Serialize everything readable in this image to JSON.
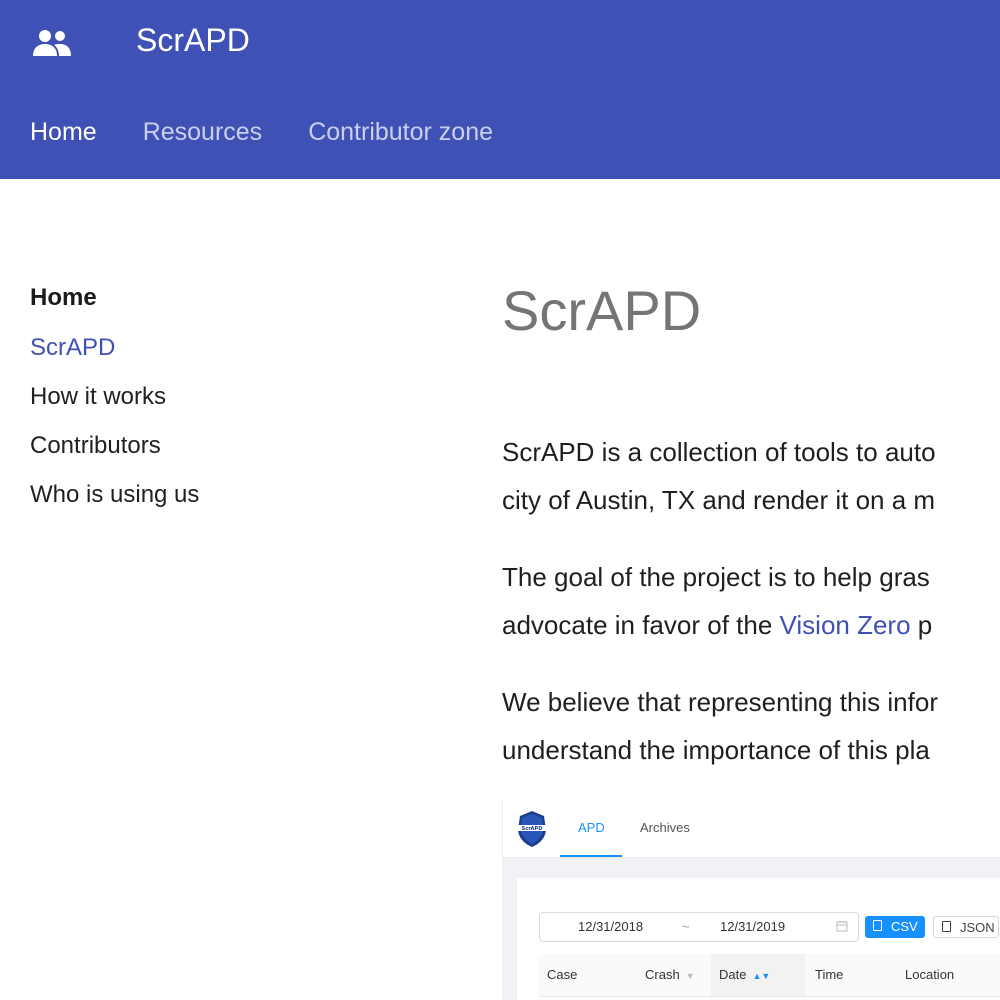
{
  "header": {
    "site_title": "ScrAPD",
    "logo_icon": "people-icon",
    "tabs": [
      {
        "label": "Home",
        "active": true
      },
      {
        "label": "Resources",
        "active": false
      },
      {
        "label": "Contributor zone",
        "active": false
      }
    ]
  },
  "sidebar": {
    "title": "Home",
    "items": [
      {
        "label": "ScrAPD",
        "active": true
      },
      {
        "label": "How it works",
        "active": false
      },
      {
        "label": "Contributors",
        "active": false
      },
      {
        "label": "Who is using us",
        "active": false
      }
    ]
  },
  "content": {
    "heading": "ScrAPD",
    "p1_line1": "ScrAPD is a collection of tools to auto",
    "p1_line2": "city of Austin, TX and render it on a m",
    "p2_line1": "The goal of the project is to help gras",
    "p2_line2_pre": "advocate in favor of the ",
    "p2_link": "Vision Zero",
    "p2_line2_post": " p",
    "p3_line1": "We believe that representing this infor",
    "p3_line2": "understand the importance of this pla"
  },
  "screenshot": {
    "badge_text": "ScrAPD",
    "tabs": [
      {
        "label": "APD",
        "active": true
      },
      {
        "label": "Archives",
        "active": false
      }
    ],
    "date_from": "12/31/2018",
    "date_sep": "~",
    "date_to": "12/31/2019",
    "calendar_icon": "calendar-icon",
    "csv_label": "CSV",
    "json_label": "JSON",
    "columns": [
      "Case",
      "Crash",
      "Date",
      "Time",
      "Location"
    ],
    "colors": {
      "accent": "#1890ff",
      "header": "#3f51b5"
    }
  }
}
